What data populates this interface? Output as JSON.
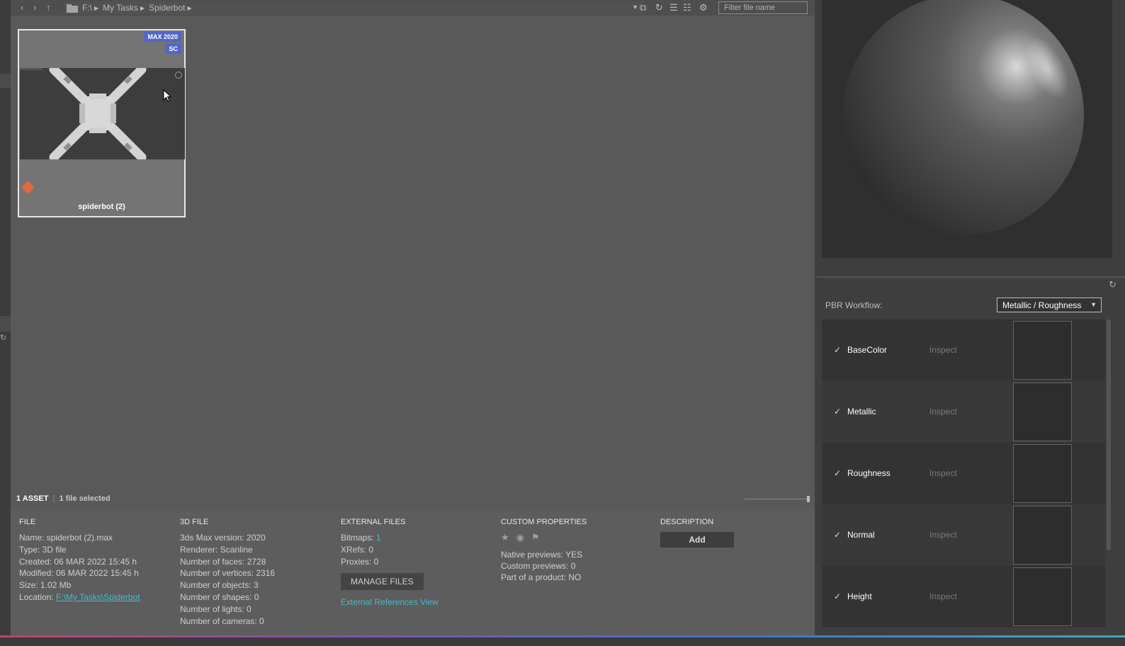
{
  "toolbar": {
    "breadcrumbs": [
      "F:\\",
      "My Tasks",
      "Spiderbot"
    ],
    "filter_placeholder": "Filter file name"
  },
  "asset_card": {
    "badges": [
      "MAX 2020",
      "SC"
    ],
    "name": "spiderbot (2)",
    "diamond_color": "#e2693b"
  },
  "status": {
    "asset_count": "1 ASSET",
    "selected": "1 file selected"
  },
  "info": {
    "file": {
      "title": "FILE",
      "lines": [
        "Name:  spiderbot (2).max",
        "Type: 3D file",
        "Created: 06 MAR 2022 15:45 h",
        "Modified: 06 MAR 2022 15:45 h",
        "Size: 1.02 Mb"
      ],
      "location_label": "Location:",
      "location_value": "F:\\My Tasks\\Spiderbot"
    },
    "file3d": {
      "title": "3D FILE",
      "lines": [
        "3ds Max version: 2020",
        "Renderer: Scanline",
        "Number of faces: 2728",
        "Number of vertices: 2316",
        "Number of objects: 3",
        "Number of shapes: 0",
        "Number of lights: 0",
        "Number of cameras: 0"
      ]
    },
    "external": {
      "title": "EXTERNAL FILES",
      "bitmaps_label": "Bitmaps:",
      "bitmaps_value": "1",
      "xrefs": "XRefs: 0",
      "proxies": "Proxies: 0",
      "manage_button": "MANAGE FILES",
      "view_link": "External References View"
    },
    "custom": {
      "title": "CUSTOM PROPERTIES",
      "lines": [
        "Native previews: YES",
        "Custom previews: 0",
        "Part of a product: NO"
      ]
    },
    "description": {
      "title": "DESCRIPTION",
      "add_button": "Add"
    }
  },
  "pbr": {
    "label": "PBR Workflow:",
    "selected": "Metallic / Roughness",
    "inspect_label": "Inspect",
    "channels": [
      "BaseColor",
      "Metallic",
      "Roughness",
      "Normal",
      "Height"
    ]
  },
  "colors": {
    "accent_link": "#4ab9c6",
    "badge": "#5365c7"
  }
}
